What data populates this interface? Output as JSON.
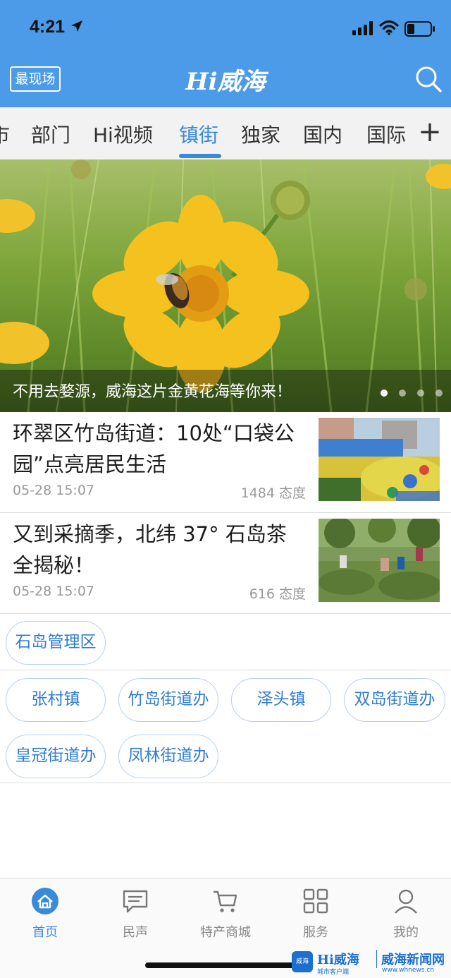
{
  "status_bar": {
    "time": "4:21"
  },
  "header": {
    "left_button_label": "最现场",
    "title": "Hi威海"
  },
  "tabs": [
    {
      "label": "市"
    },
    {
      "label": "部门"
    },
    {
      "label": "Hi视频"
    },
    {
      "label": "镇街",
      "active": true
    },
    {
      "label": "独家"
    },
    {
      "label": "国内"
    },
    {
      "label": "国际"
    }
  ],
  "tabs_add_label": "+",
  "banner": {
    "caption": "不用去婺源，威海这片金黄花海等你来！",
    "slide_count": 4,
    "active_slide": 1
  },
  "news": [
    {
      "title": "环翠区竹岛街道：10处“口袋公园”点亮居民生活",
      "date": "05-28 15:07",
      "meta": "1484 态度"
    },
    {
      "title": "又到采摘季，北纬 37° 石岛茶全揭秘！",
      "date": "05-28 15:07",
      "meta": "616 态度"
    }
  ],
  "regions": {
    "primary": "石岛管理区",
    "towns": [
      "张村镇",
      "竹岛街道办",
      "泽头镇",
      "双岛街道办",
      "皇冠街道办",
      "凤林街道办"
    ]
  },
  "bottom_nav": [
    {
      "label": "首页",
      "icon": "home-icon",
      "active": true
    },
    {
      "label": "民声",
      "icon": "message-icon"
    },
    {
      "label": "特产商城",
      "icon": "cart-icon"
    },
    {
      "label": "服务",
      "icon": "grid-icon"
    },
    {
      "label": "我的",
      "icon": "user-icon"
    }
  ],
  "watermark": {
    "badge": "威海",
    "brand": "Hi威海",
    "brand_sub": "城市客户端",
    "site": "威海新闻网",
    "site_url": "www.whnews.cn"
  },
  "colors": {
    "header_bg": "#4b9be8",
    "accent": "#3b8ad8",
    "pill_border": "#b7cfee"
  }
}
